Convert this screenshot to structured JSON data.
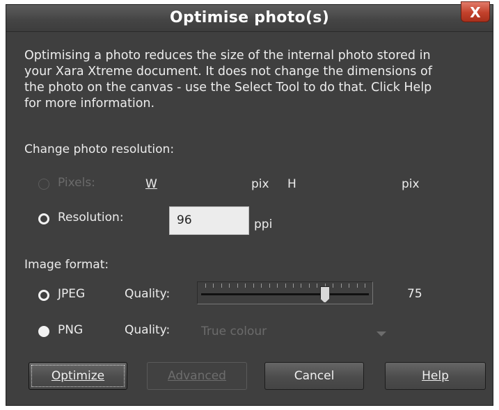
{
  "window": {
    "title": "Optimise photo(s)",
    "close_label": "X"
  },
  "description": [
    "Optimising a photo reduces the size of the internal photo stored in",
    "your Xara Xtreme document. It does not change the dimensions of",
    "the photo on the canvas - use the Select Tool to do that. Click Help",
    "for more information."
  ],
  "resolution_section": {
    "heading": "Change photo resolution:",
    "pixels_label": "Pixels:",
    "w_label": "W",
    "pix_label_1": "pix",
    "h_label": "H",
    "pix_label_2": "pix",
    "resolution_label": "Resolution:",
    "resolution_value": "96",
    "ppi_label": "ppi"
  },
  "format_section": {
    "heading": "Image format:",
    "jpeg_label": "JPEG",
    "jpeg_quality_label": "Quality:",
    "jpeg_quality_value": "75",
    "jpeg_quality_level": 0.75,
    "png_label": "PNG",
    "png_quality_label": "Quality:",
    "png_quality_value": "True colour"
  },
  "buttons": {
    "optimize": "Optimize",
    "advanced": "Advanced",
    "cancel": "Cancel",
    "help": "Help"
  },
  "colors": {
    "dialog_bg": "#3f3f3f",
    "close_button": "#c2412b",
    "text": "#ececec",
    "disabled_text": "#6b6b6b"
  }
}
